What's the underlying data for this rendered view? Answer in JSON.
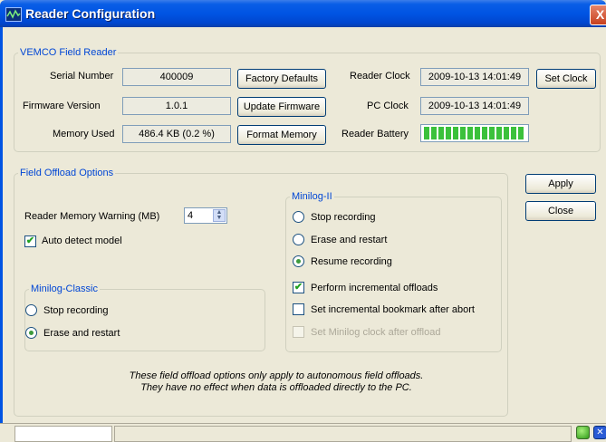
{
  "window": {
    "title": "Reader Configuration",
    "close_label": "X"
  },
  "field_reader": {
    "legend": "VEMCO Field Reader",
    "serial_number_label": "Serial Number",
    "serial_number_value": "400009",
    "firmware_label": "Firmware Version",
    "firmware_value": "1.0.1",
    "memory_label": "Memory Used",
    "memory_value": "486.4 KB (0.2 %)",
    "factory_defaults_button": "Factory Defaults",
    "update_firmware_button": "Update Firmware",
    "format_memory_button": "Format Memory",
    "reader_clock_label": "Reader Clock",
    "reader_clock_value": "2009-10-13 14:01:49",
    "set_clock_button": "Set Clock",
    "pc_clock_label": "PC Clock",
    "pc_clock_value": "2009-10-13 14:01:49",
    "battery_label": "Reader Battery",
    "battery_level": 1.0,
    "battery_color": "#3bc13b"
  },
  "offload": {
    "legend": "Field Offload Options",
    "memory_warning_label": "Reader Memory Warning (MB)",
    "memory_warning_value": "4",
    "auto_detect_label": "Auto detect model",
    "auto_detect_checked": true,
    "classic": {
      "legend": "Minilog-Classic",
      "stop_label": "Stop recording",
      "erase_label": "Erase and restart",
      "selected": "erase"
    },
    "minilog2": {
      "legend": "Minilog-II",
      "stop_label": "Stop recording",
      "erase_label": "Erase and restart",
      "resume_label": "Resume recording",
      "selected": "resume",
      "incremental_label": "Perform incremental offloads",
      "incremental_checked": true,
      "bookmark_label": "Set incremental bookmark after abort",
      "bookmark_checked": false,
      "set_clock_label": "Set Minilog clock after offload",
      "set_clock_enabled": false
    },
    "note_line1": "These field offload options only apply to autonomous field offloads.",
    "note_line2": "They have no effect when data is offloaded directly to the PC."
  },
  "actions": {
    "apply_button": "Apply",
    "close_button": "Close"
  },
  "colors": {
    "title_bar": "#0054e3",
    "group_legend": "#0046d5",
    "window_bg": "#ece9d8"
  }
}
